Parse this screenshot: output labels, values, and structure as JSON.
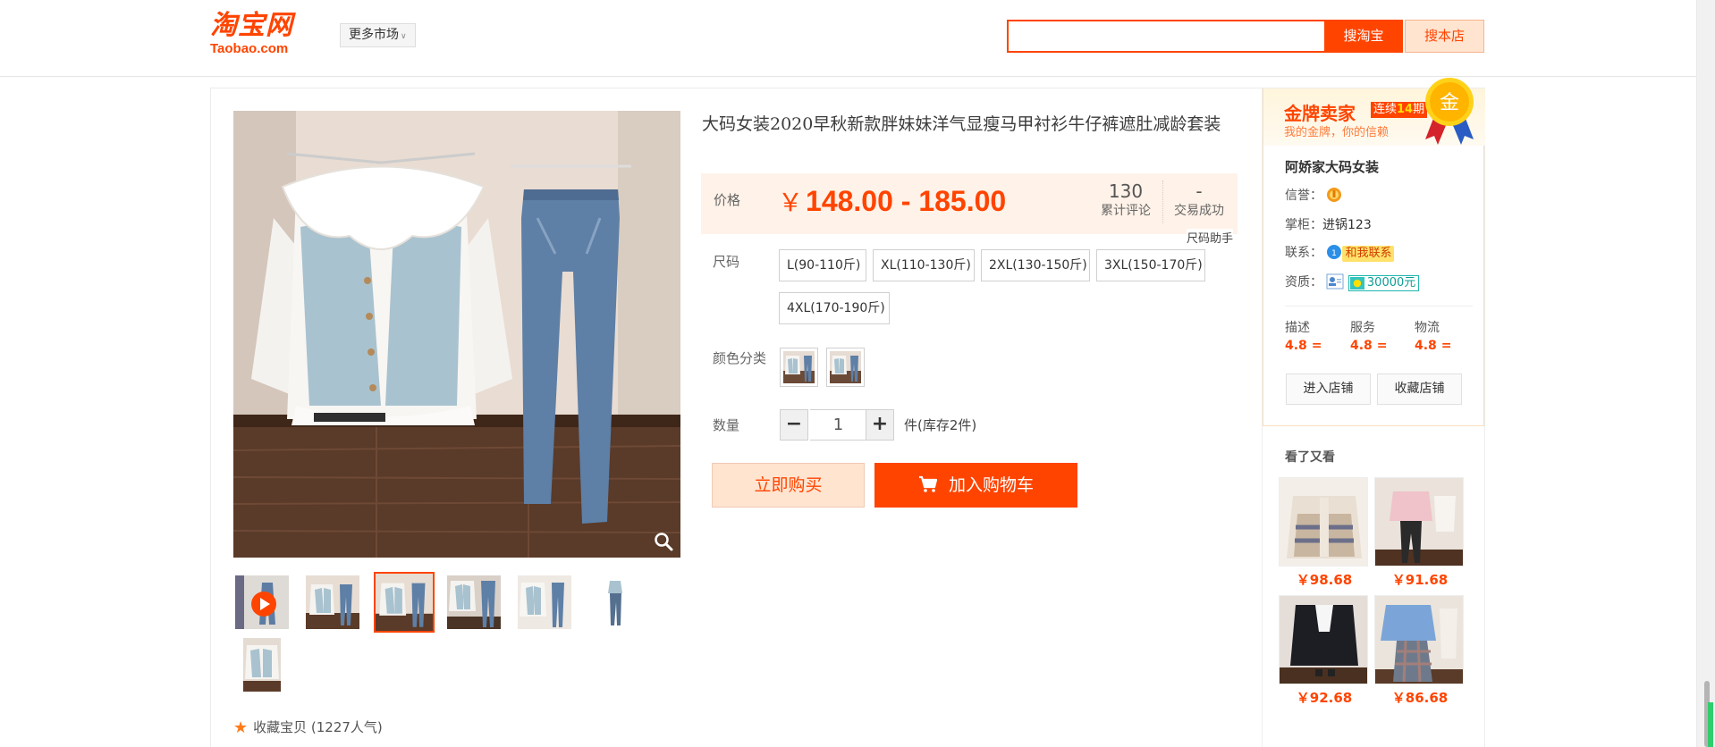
{
  "header": {
    "logo_cn": "淘宝网",
    "logo_en": "Taobao.com",
    "market_label": "更多市场",
    "search_placeholder": "",
    "search_button": "搜淘宝",
    "shop_search_button": "搜本店"
  },
  "product": {
    "title": "大码女装2020早秋新款胖妹妹洋气显瘦马甲衬衫牛仔裤遮肚减龄套装",
    "price_label": "价格",
    "price_currency": "￥",
    "price_range": "148.00 - 185.00",
    "reviews_count": "130",
    "reviews_label": "累计评论",
    "deals_count": "-",
    "deals_label": "交易成功",
    "size_helper": "尺码助手",
    "size_label": "尺码",
    "sizes": [
      "L(90-110斤)",
      "XL(110-130斤)",
      "2XL(130-150斤)",
      "3XL(150-170斤)",
      "4XL(170-190斤)"
    ],
    "color_label": "颜色分类",
    "qty_label": "数量",
    "qty_minus": "−",
    "qty_plus": "+",
    "qty_value": "1",
    "stock_text": "件(库存2件)",
    "buy_now": "立即购买",
    "add_to_cart": "加入购物车",
    "favorite_text": "收藏宝贝 (1227人气)"
  },
  "seller": {
    "gold_title": "金牌卖家",
    "gold_badge_prefix": "连续",
    "gold_badge_num": "14",
    "gold_badge_suffix": "期",
    "gold_sub": "我的金牌，你的信赖",
    "medal_text": "金",
    "shop_name": "阿娇家大码女装",
    "credit_label": "信誉：",
    "owner_label": "掌柜：",
    "owner_name": "进锅123",
    "contact_label": "联系：",
    "contact_tag": "和我联系",
    "qualification_label": "资质：",
    "deposit": "30000元",
    "ratings": [
      {
        "label": "描述",
        "value": "4.8",
        "trend": "="
      },
      {
        "label": "服务",
        "value": "4.8",
        "trend": "="
      },
      {
        "label": "物流",
        "value": "4.8",
        "trend": "="
      }
    ],
    "enter_shop": "进入店铺",
    "fav_shop": "收藏店铺"
  },
  "see_also": {
    "title": "看了又看",
    "items": [
      {
        "price": "￥98.68"
      },
      {
        "price": "￥91.68"
      },
      {
        "price": "￥92.68"
      },
      {
        "price": "￥86.68"
      }
    ]
  },
  "colors": {
    "accent": "#ff4400",
    "price_bg": "#fff2e8",
    "buy_now_bg": "#ffe4d0"
  }
}
